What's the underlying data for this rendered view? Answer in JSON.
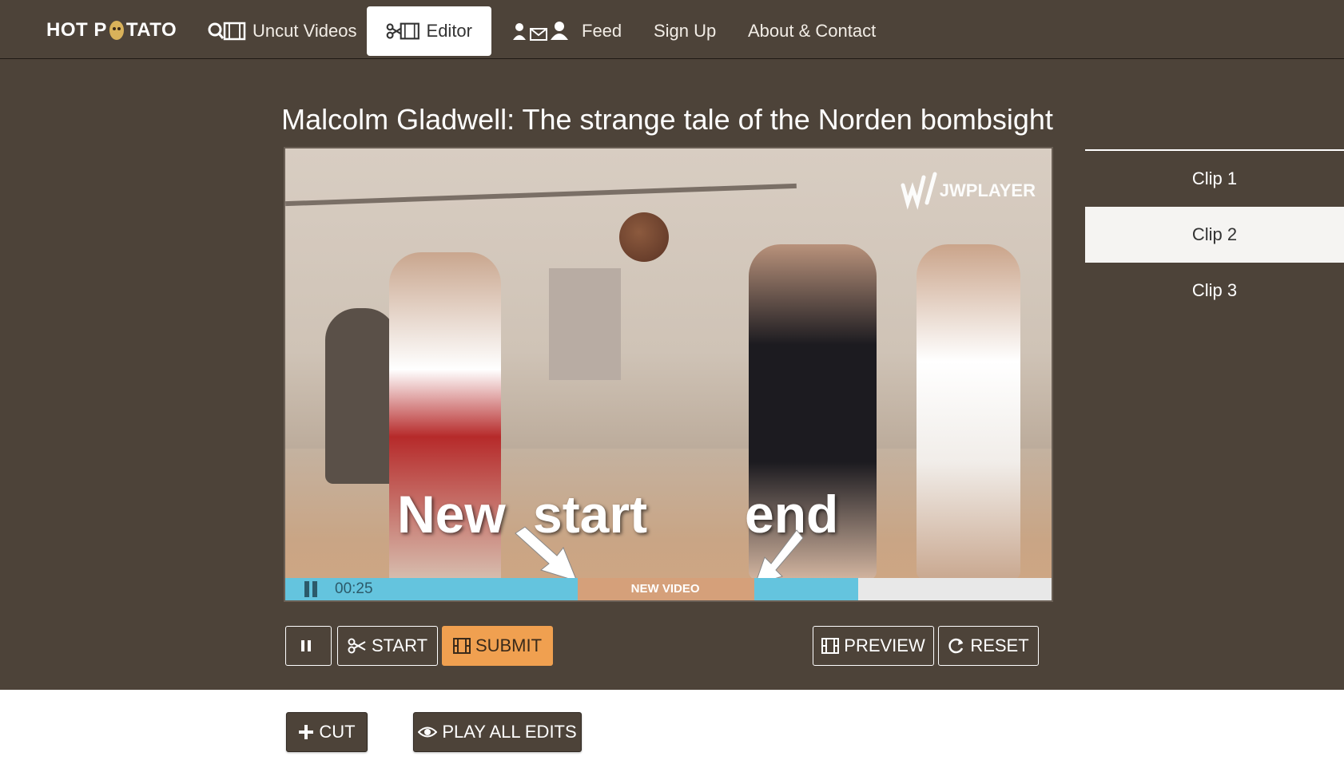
{
  "nav": {
    "brand_left": "HOT P",
    "brand_right": "TATO",
    "items": [
      {
        "label": "Uncut Videos",
        "icon": "search-film-icon"
      },
      {
        "label": "Editor",
        "icon": "scissors-film-icon",
        "active": true
      },
      {
        "label": "Feed",
        "icon": "users-mail-icon"
      },
      {
        "label": "Sign Up"
      },
      {
        "label": "About & Contact"
      }
    ]
  },
  "video": {
    "title": "Malcolm Gladwell: The strange tale of the Norden bombsight",
    "watermark": "JWPLAYER",
    "overlay_new": "New",
    "overlay_start": "start",
    "overlay_end": "end",
    "time": "00:25",
    "segment_label": "NEW  VIDEO",
    "played_fraction": 0.745,
    "selection_start_fraction": 0.38,
    "selection_end_fraction": 0.61
  },
  "controls": {
    "pause_label": "",
    "start_label": "START",
    "submit_label": "SUBMIT",
    "preview_label": "PREVIEW",
    "reset_label": "RESET"
  },
  "actions": {
    "cut_label": "CUT",
    "play_all_label": "PLAY ALL EDITS"
  },
  "clips": [
    {
      "label": "Clip 1",
      "active": false
    },
    {
      "label": "Clip 2",
      "active": true
    },
    {
      "label": "Clip 3",
      "active": false
    }
  ],
  "colors": {
    "background": "#4d4339",
    "accent_orange": "#f0a050",
    "progress_blue": "#64c4de"
  }
}
